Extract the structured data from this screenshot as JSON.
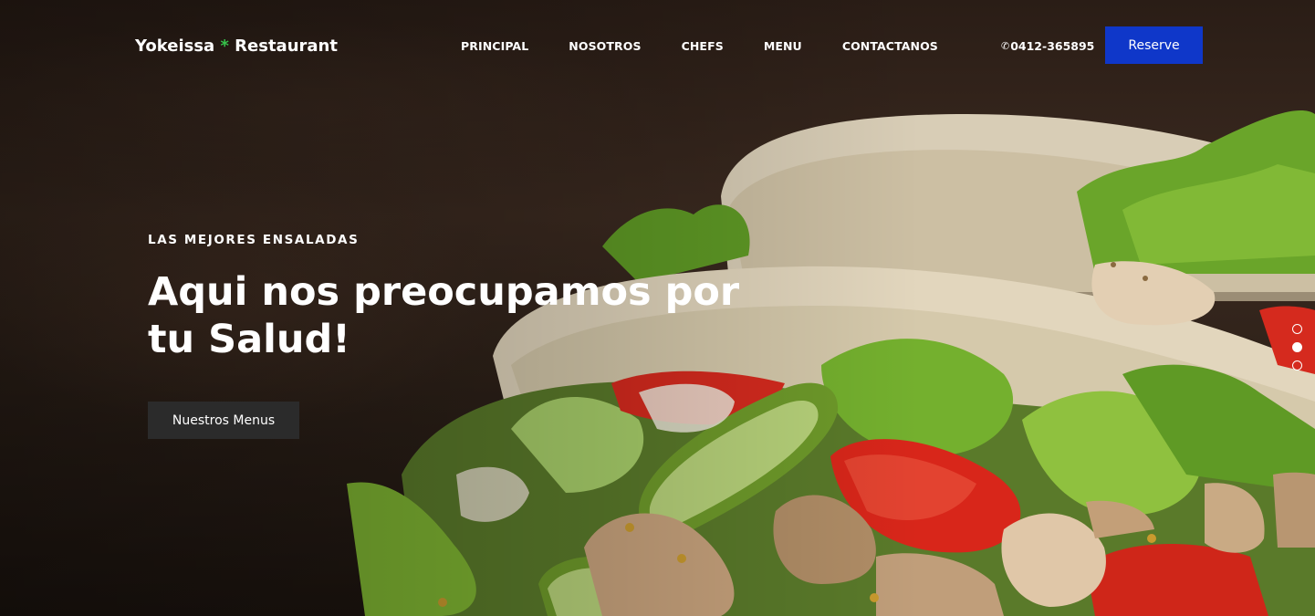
{
  "brand": {
    "name_part1": "Yokeissa",
    "separator": "*",
    "name_part2": "Restaurant",
    "accent_color": "#36c24a"
  },
  "nav": {
    "items": [
      {
        "label": "PRINCIPAL"
      },
      {
        "label": "NOSOTROS"
      },
      {
        "label": "CHEFS"
      },
      {
        "label": "MENU"
      },
      {
        "label": "CONTACTANOS"
      }
    ]
  },
  "contact": {
    "phone_icon": "phone-icon",
    "phone_glyph": "✆",
    "phone": "0412-365895"
  },
  "cta": {
    "reserve_label": "Reserve",
    "reserve_color": "#0f37c9"
  },
  "hero": {
    "eyebrow": "LAS MEJORES ENSALADAS",
    "headline": "Aqui nos preocupamos por tu Salud!",
    "button_label": "Nuestros Menus"
  },
  "slider": {
    "count": 3,
    "active_index": 1
  }
}
